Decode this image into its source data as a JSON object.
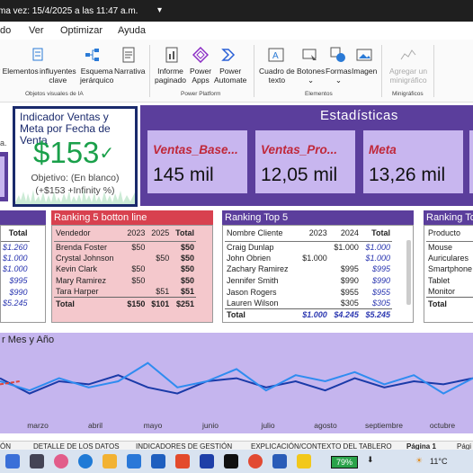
{
  "titlebar": {
    "saved_text": "ma vez: 15/4/2025 a las 11:47 a.m."
  },
  "menu": [
    "do",
    "Ver",
    "Optimizar",
    "Ayuda"
  ],
  "ribbon": {
    "buttons": [
      {
        "label": "y Elementos",
        "sub": ""
      },
      {
        "label": "influyentes",
        "sub": "clave"
      },
      {
        "label": "Esquema",
        "sub": "jerárquico"
      },
      {
        "label": "Narrativa",
        "sub": ""
      },
      {
        "label": "Informe",
        "sub": "paginado"
      },
      {
        "label": "Power",
        "sub": "Apps"
      },
      {
        "label": "Power",
        "sub": "Automate"
      },
      {
        "label": "Cuadro de",
        "sub": "texto"
      },
      {
        "label": "Botones",
        "sub": ""
      },
      {
        "label": "Formas",
        "sub": ""
      },
      {
        "label": "Imagen",
        "sub": ""
      },
      {
        "label": "Agregar un",
        "sub": "minigráfico"
      }
    ],
    "groups": [
      "Objetos visuales de IA",
      "Power Platform",
      "Elementos",
      "Minigráficos"
    ]
  },
  "kpi": {
    "title": "Indicador Ventas y Meta por Fecha de Venta",
    "value": "$153",
    "goal": "Objetivo: (En blanco)",
    "delta": "(+$153 +Infinity %)"
  },
  "stats": {
    "title": "Estadísticas",
    "cards": [
      {
        "label": "Ventas_Base...",
        "value": "145 mil"
      },
      {
        "label": "Ventas_Pro...",
        "value": "12,05 mil"
      },
      {
        "label": "Meta",
        "value": "13,26 mil"
      }
    ]
  },
  "left_fragment_label": "a.",
  "table_left": {
    "header": "Total",
    "values": [
      "$1.260",
      "$1.000",
      "$1.000",
      "$995",
      "$990",
      "$5.245"
    ]
  },
  "table_bottom5": {
    "title": "Ranking 5 botton line",
    "columns": [
      "Vendedor",
      "2023",
      "2025",
      "Total"
    ],
    "rows": [
      [
        "Brenda Foster",
        "$50",
        "",
        "$50"
      ],
      [
        "Crystal Johnson",
        "",
        "$50",
        "$50"
      ],
      [
        "Kevin Clark",
        "$50",
        "",
        "$50"
      ],
      [
        "Mary Ramirez",
        "$50",
        "",
        "$50"
      ],
      [
        "Tara Harper",
        "",
        "$51",
        "$51"
      ]
    ],
    "total": [
      "Total",
      "$150",
      "$101",
      "$251"
    ]
  },
  "table_top5": {
    "title": "Ranking Top 5",
    "columns": [
      "Nombre Cliente",
      "2023",
      "2024",
      "Total"
    ],
    "rows": [
      [
        "Craig Dunlap",
        "",
        "$1.000",
        "$1.000"
      ],
      [
        "John Obrien",
        "$1.000",
        "",
        "$1.000"
      ],
      [
        "Zachary Ramirez",
        "",
        "$995",
        "$995"
      ],
      [
        "Jennifer Smith",
        "",
        "$990",
        "$990"
      ],
      [
        "Jason Rogers",
        "",
        "$955",
        "$955"
      ],
      [
        "Lauren Wilson",
        "",
        "$305",
        "$305"
      ]
    ],
    "total": [
      "Total",
      "$1.000",
      "$4.245",
      "$5.245"
    ]
  },
  "table_right": {
    "title": "Ranking To",
    "columns": [
      "Producto"
    ],
    "rows": [
      "Mouse",
      "Auriculares",
      "Smartphone",
      "Tablet",
      "Monitor"
    ],
    "total": "Total"
  },
  "line_chart": {
    "title": "r Mes y Año",
    "months": [
      "marzo",
      "abril",
      "mayo",
      "junio",
      "julio",
      "agosto",
      "septiembre",
      "octubre"
    ]
  },
  "chart_data": {
    "type": "line",
    "title": "r Mes y Año",
    "categories": [
      "marzo",
      "abril",
      "mayo",
      "junio",
      "julio",
      "agosto",
      "septiembre",
      "octubre"
    ],
    "series": [
      {
        "color": "#1a3aa8",
        "values": [
          0.55,
          0.3,
          0.5,
          0.45,
          0.6,
          0.4,
          0.3,
          0.5,
          0.55,
          0.4,
          0.5,
          0.35,
          0.55,
          0.4,
          0.5,
          0.45,
          0.55
        ]
      },
      {
        "color": "#2f8cf0",
        "values": [
          0.5,
          0.35,
          0.55,
          0.4,
          0.5,
          0.8,
          0.4,
          0.5,
          0.7,
          0.35,
          0.6,
          0.5,
          0.65,
          0.45,
          0.6,
          0.3,
          0.55
        ]
      },
      {
        "color": "#e0463c",
        "values": [
          0.45,
          0.5
        ]
      }
    ]
  },
  "pagetabs": [
    "ÓN",
    "DETALLE DE LOS DATOS",
    "INDICADORES DE GESTIÓN",
    "EXPLICACIÓN/CONTEXTO DEL TABLERO",
    "Página 1",
    "Pági"
  ],
  "taskbar": {
    "battery": "79%",
    "temp": "11°C"
  }
}
